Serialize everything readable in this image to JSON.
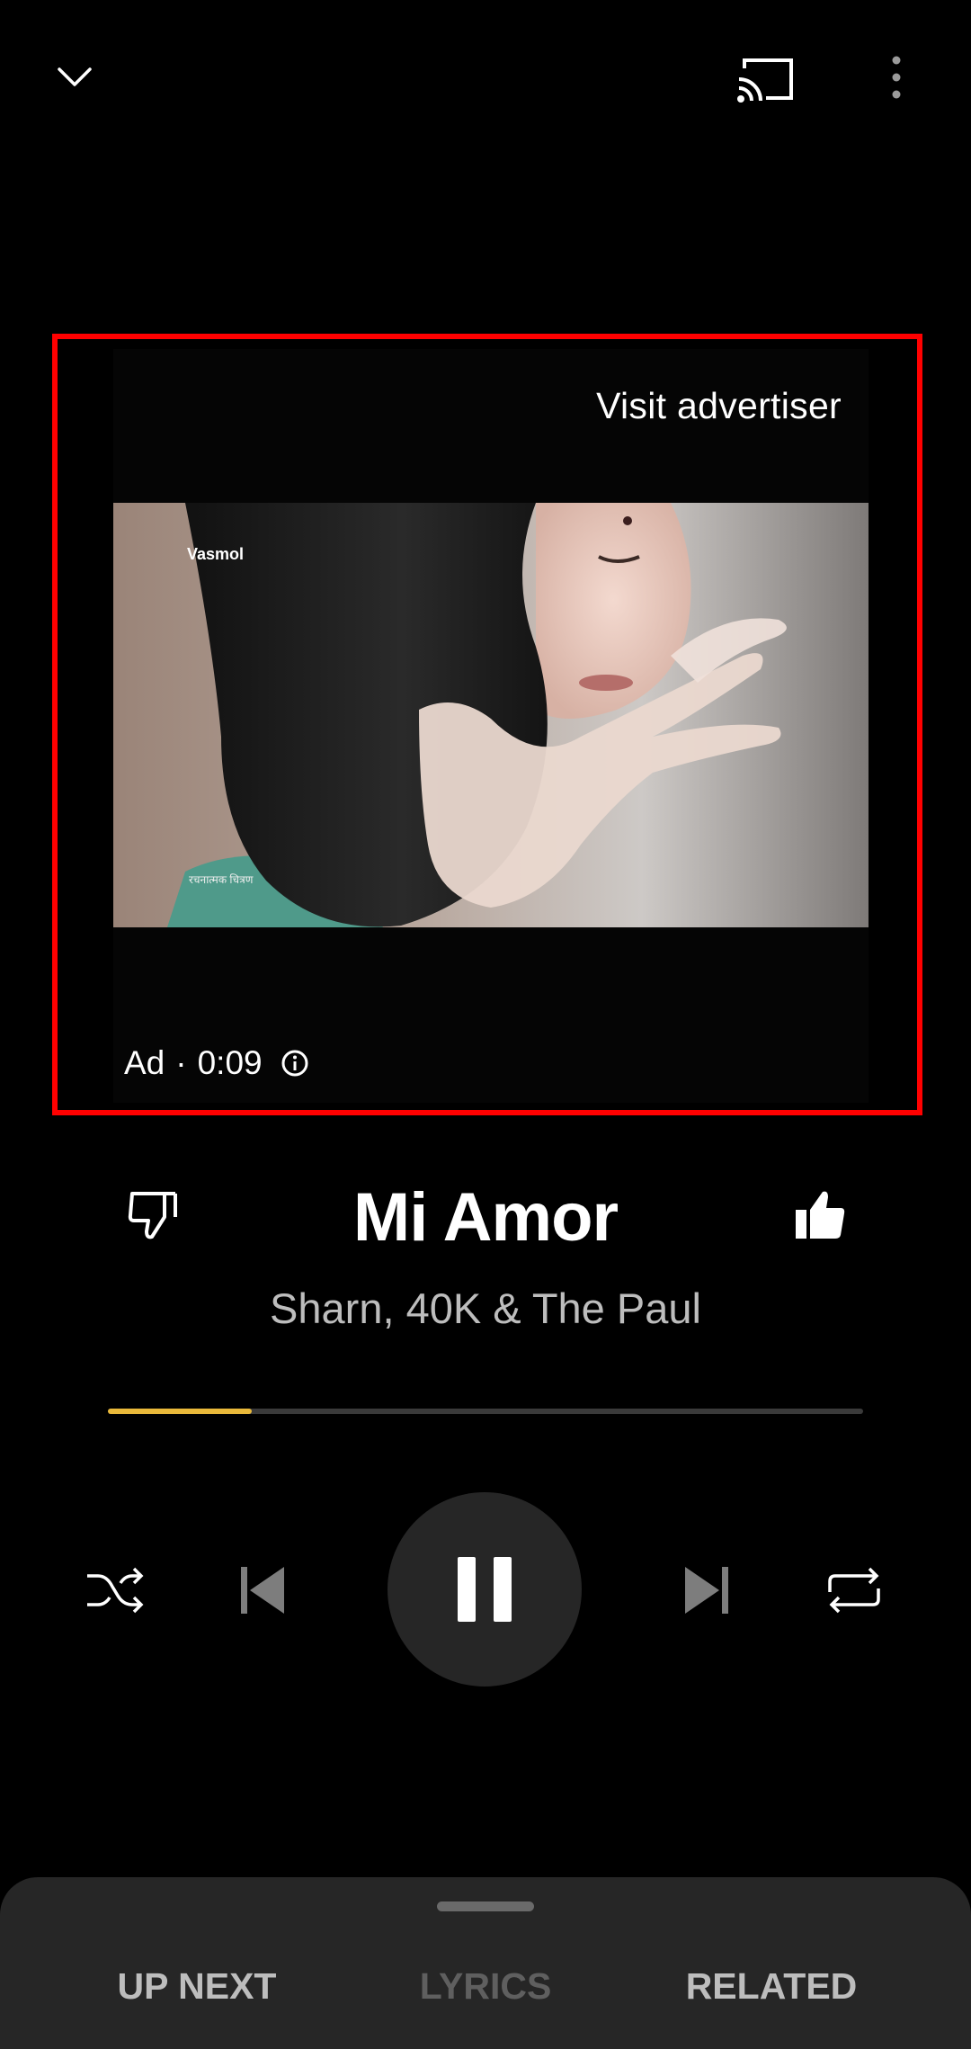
{
  "top_bar": {
    "collapse_icon": "chevron-down-icon",
    "cast_icon": "cast-icon",
    "more_icon": "more-vert-icon"
  },
  "ad": {
    "visit_label": "Visit advertiser",
    "brand_watermark": "Vasmol",
    "disclaimer_text": "रचनात्मक चित्रण",
    "ad_label": "Ad",
    "separator": "·",
    "remaining_time": "0:09",
    "info_icon": "info-icon"
  },
  "song": {
    "title": "Mi Amor",
    "artist": "Sharn, 40K & The Paul",
    "dislike_icon": "thumbs-down-icon",
    "like_icon": "thumbs-up-icon",
    "progress_fraction": 0.19
  },
  "controls": {
    "shuffle_icon": "shuffle-icon",
    "previous_icon": "skip-previous-icon",
    "pause_icon": "pause-icon",
    "next_icon": "skip-next-icon",
    "repeat_icon": "repeat-icon"
  },
  "bottom_tabs": [
    {
      "label": "UP NEXT",
      "color": "#bdbdbd"
    },
    {
      "label": "LYRICS",
      "color": "#5f5f5f"
    },
    {
      "label": "RELATED",
      "color": "#bdbdbd"
    }
  ],
  "colors": {
    "accent": "#e9b93a",
    "ad_highlight": "#ff0000",
    "background": "#000000",
    "sheet": "#262626"
  }
}
